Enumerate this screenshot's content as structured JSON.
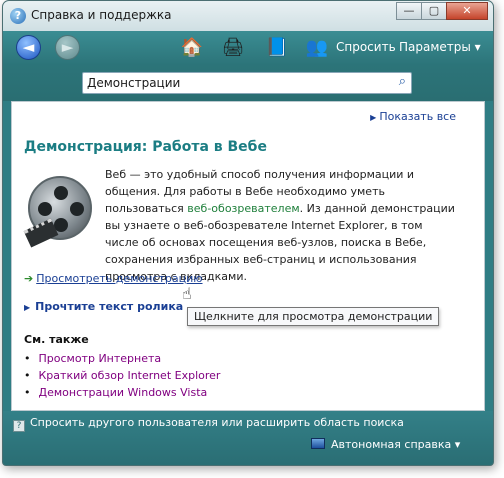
{
  "window": {
    "title": "Справка и поддержка",
    "minimize": "—",
    "maximize": "▢",
    "close": "✕"
  },
  "toolbar": {
    "back": "◄",
    "forward": "►",
    "ask_label": "Спросить",
    "params_label": "Параметры ▾"
  },
  "search": {
    "value": "Демонстрации",
    "placeholder": ""
  },
  "content": {
    "show_all": "Показать все",
    "title": "Демонстрация: Работа в Вебе",
    "desc_part1": "Веб — это удобный способ получения информации и общения. Для работы в Вебе необходимо уметь пользоваться ",
    "desc_link": "веб-обозревателем",
    "desc_part2": ". Из данной демонстрации вы узнаете о веб-обозревателе Internet Explorer, в том числе об основах посещения веб-узлов, поиска в Вебе, сохранения избранных веб-страниц и использования просмотра с вкладками.",
    "demo_link": "Просмотреть демонстрацию",
    "tooltip": "Щелкните для просмотра демонстрации",
    "script_link": "Прочтите текст ролика",
    "see_also_heading": "См. также",
    "see_also": [
      "Просмотр Интернета",
      "Краткий обзор Internet Explorer",
      "Демонстрации Windows Vista"
    ]
  },
  "bottom": {
    "ask_other": "Спросить другого пользователя или расширить область поиска",
    "offline_help": "Автономная справка ▾"
  },
  "colors": {
    "frame": "#2f7d84",
    "title_green": "#1b7d83",
    "link_blue": "#1a3f94",
    "visited_purple": "#800080"
  }
}
